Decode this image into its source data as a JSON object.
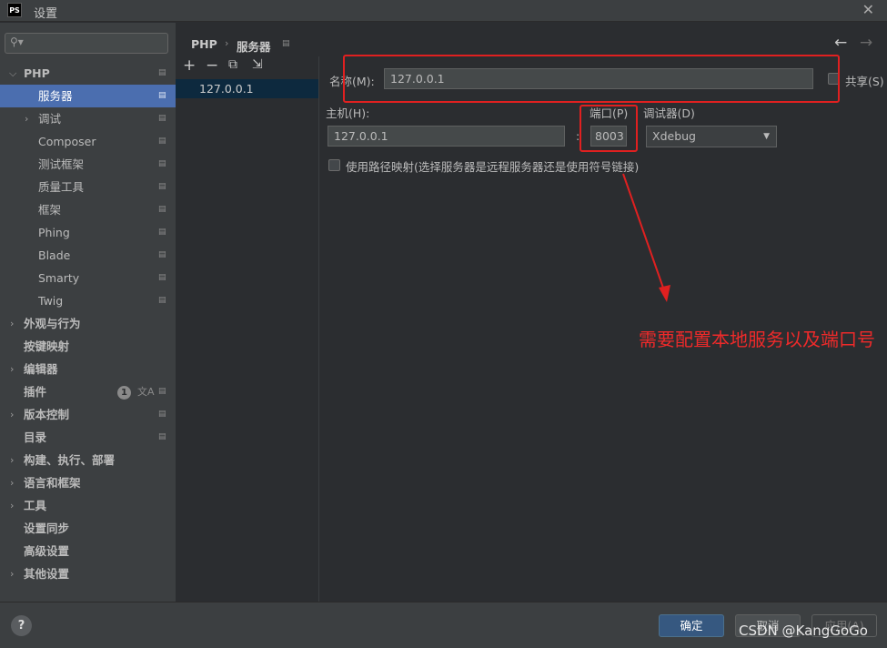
{
  "window": {
    "app_icon": "PS",
    "title": "设置",
    "close": "✕"
  },
  "search": {
    "value": ""
  },
  "sidebar": {
    "items": [
      {
        "label": "PHP"
      },
      {
        "label": "服务器"
      },
      {
        "label": "调试"
      },
      {
        "label": "Composer"
      },
      {
        "label": "测试框架"
      },
      {
        "label": "质量工具"
      },
      {
        "label": "框架"
      },
      {
        "label": "Phing"
      },
      {
        "label": "Blade"
      },
      {
        "label": "Smarty"
      },
      {
        "label": "Twig"
      },
      {
        "label": "外观与行为"
      },
      {
        "label": "按键映射"
      },
      {
        "label": "编辑器"
      },
      {
        "label": "插件",
        "badge": "1"
      },
      {
        "label": "版本控制"
      },
      {
        "label": "目录"
      },
      {
        "label": "构建、执行、部署"
      },
      {
        "label": "语言和框架"
      },
      {
        "label": "工具"
      },
      {
        "label": "设置同步"
      },
      {
        "label": "高级设置"
      },
      {
        "label": "其他设置"
      }
    ]
  },
  "breadcrumb": {
    "part1": "PHP",
    "sep": "›",
    "part2": "服务器"
  },
  "toolbar": {
    "add": "+",
    "remove": "−",
    "copy": "⧉",
    "import": "⇲"
  },
  "servers": [
    {
      "label": "127.0.0.1"
    }
  ],
  "form": {
    "name_label": "名称(M):",
    "name_value": "127.0.0.1",
    "share_label": "共享(S)",
    "host_label": "主机(H):",
    "host_value": "127.0.0.1",
    "colon": ":",
    "port_label": "端口(P)",
    "port_value": "8003",
    "debugger_label": "调试器(D)",
    "debugger_value": "Xdebug",
    "path_mapping_label": "使用路径映射(选择服务器是远程服务器还是使用符号链接)"
  },
  "annotation": {
    "text": "需要配置本地服务以及端口号",
    "color": "#ee2a2a"
  },
  "footer": {
    "help": "?",
    "ok": "确定",
    "cancel": "取消",
    "apply": "应用(A)",
    "watermark": "CSDN @KangGoGo"
  },
  "colors": {
    "selection": "#4b6eaf",
    "primary_button": "#365880",
    "annotation_red": "#e02020"
  }
}
